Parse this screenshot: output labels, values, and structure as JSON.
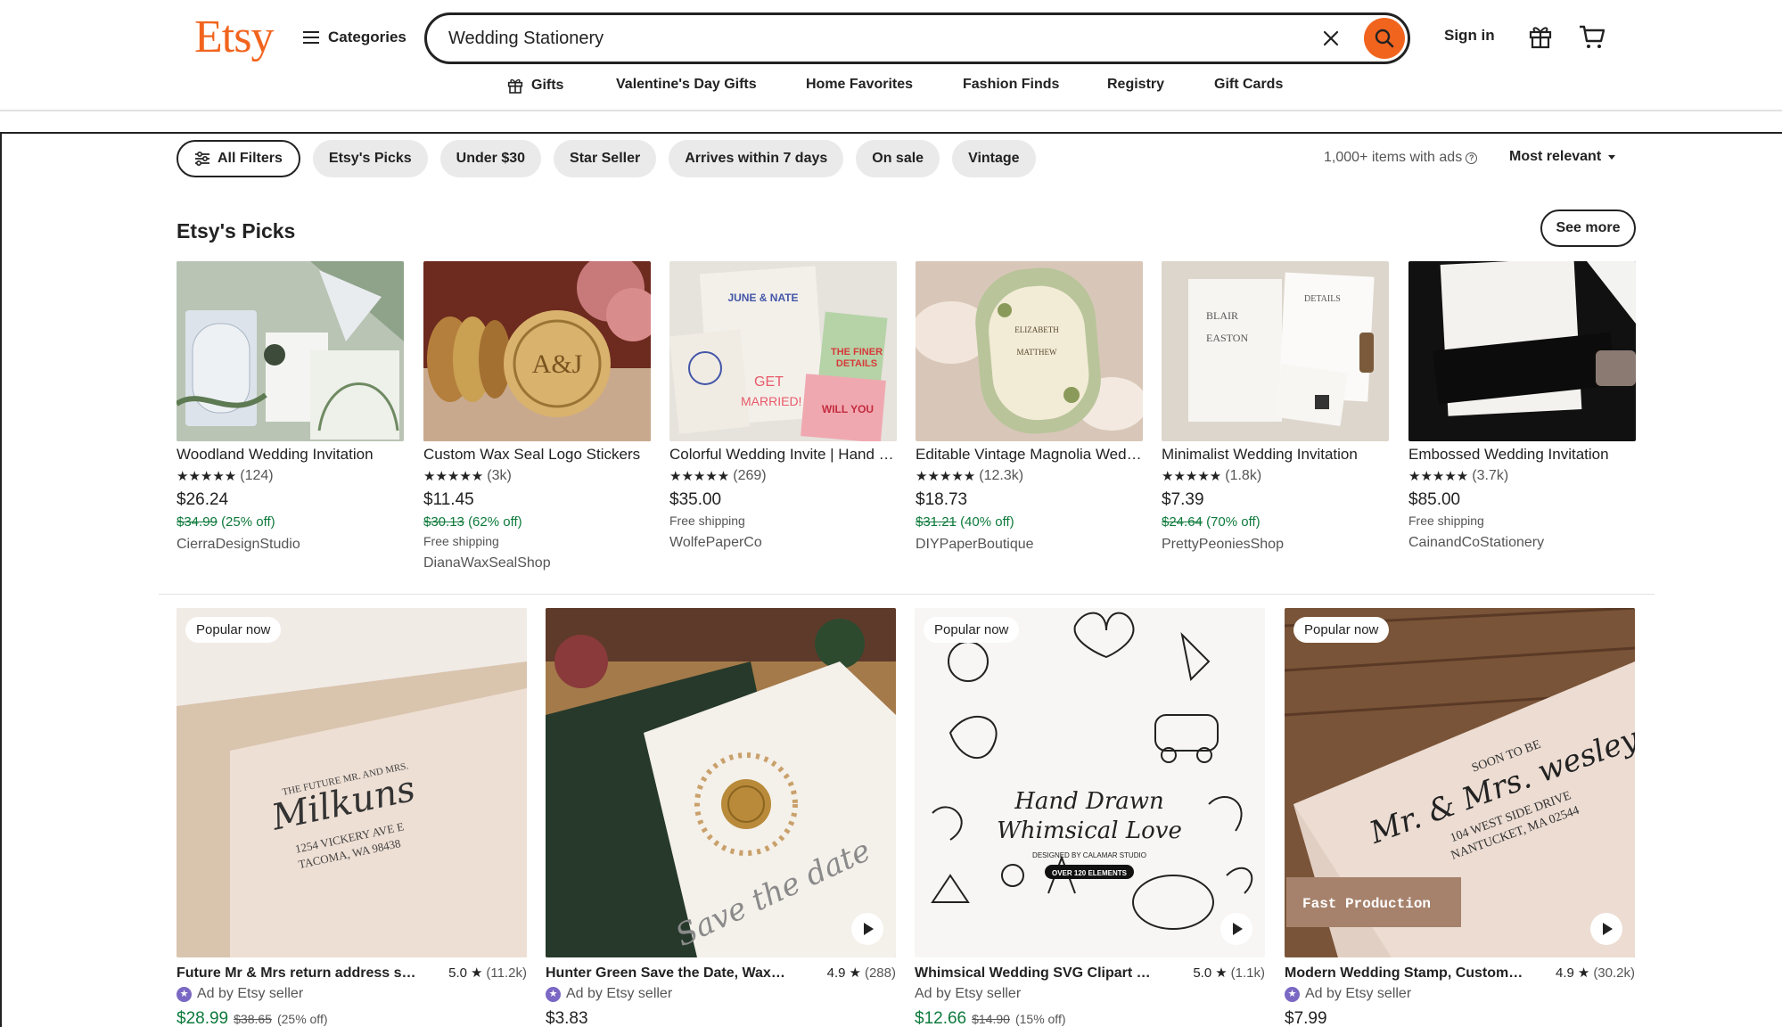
{
  "header": {
    "logo": "Etsy",
    "categories_label": "Categories",
    "search_value": "Wedding Stationery",
    "sign_in": "Sign in"
  },
  "nav": [
    "Gifts",
    "Valentine's Day Gifts",
    "Home Favorites",
    "Fashion Finds",
    "Registry",
    "Gift Cards"
  ],
  "filters": {
    "all_filters": "All Filters",
    "chips": [
      "Etsy's Picks",
      "Under $30",
      "Star Seller",
      "Arrives within 7 days",
      "On sale",
      "Vintage"
    ],
    "results": "1,000+ items with ads",
    "sort": "Most relevant"
  },
  "picks": {
    "title": "Etsy's Picks",
    "see_more": "See more",
    "items": [
      {
        "title": "Woodland Wedding Invitation",
        "rating": 5,
        "count": "(124)",
        "price": "$26.24",
        "old_price": "$34.99",
        "discount": "(25% off)",
        "shipping": "",
        "shop": "CierraDesignStudio"
      },
      {
        "title": "Custom Wax Seal Logo Stickers",
        "rating": 5,
        "count": "(3k)",
        "price": "$11.45",
        "old_price": "$30.13",
        "discount": "(62% off)",
        "shipping": "Free shipping",
        "shop": "DianaWaxSealShop"
      },
      {
        "title": "Colorful Wedding Invite | Hand drawn",
        "rating": 5,
        "count": "(269)",
        "price": "$35.00",
        "old_price": "",
        "discount": "",
        "shipping": "Free shipping",
        "shop": "WolfePaperCo"
      },
      {
        "title": "Editable Vintage Magnolia Wedding",
        "rating": 5,
        "count": "(12.3k)",
        "price": "$18.73",
        "old_price": "$31.21",
        "discount": "(40% off)",
        "shipping": "",
        "shop": "DIYPaperBoutique"
      },
      {
        "title": "Minimalist Wedding Invitation",
        "rating": 5,
        "count": "(1.8k)",
        "price": "$7.39",
        "old_price": "$24.64",
        "discount": "(70% off)",
        "shipping": "",
        "shop": "PrettyPeoniesShop"
      },
      {
        "title": "Embossed Wedding Invitation",
        "rating": 5,
        "count": "(3.7k)",
        "price": "$85.00",
        "old_price": "",
        "discount": "",
        "shipping": "Free shipping",
        "shop": "CainandCoStationery"
      }
    ]
  },
  "ads": {
    "badge": "Popular now",
    "ad_label": "Ad by Etsy seller",
    "items": [
      {
        "title": "Future Mr & Mrs return address stamp",
        "score": "5.0",
        "count": "(11.2k)",
        "price": "$28.99",
        "old_price": "$38.65",
        "discount": "(25% off)",
        "popular": true,
        "video": false
      },
      {
        "title": "Hunter Green Save the Date, Wax Seal",
        "score": "4.9",
        "count": "(288)",
        "price": "$3.83",
        "old_price": "",
        "discount": "",
        "popular": false,
        "video": true
      },
      {
        "title": "Whimsical Wedding SVG Clipart Bundle",
        "score": "5.0",
        "count": "(1.1k)",
        "price": "$12.66",
        "old_price": "$14.90",
        "discount": "(15% off)",
        "popular": true,
        "video": true
      },
      {
        "title": "Modern Wedding Stamp, Custom Address",
        "score": "4.9",
        "count": "(30.2k)",
        "price": "$7.99",
        "old_price": "",
        "discount": "",
        "popular": true,
        "video": true
      }
    ],
    "stamp_text": {
      "a_line1": "THE FUTURE MR. AND MRS.",
      "a_name": "Milkuns",
      "a_line2": "1254 VICKERY AVE E",
      "a_line3": "TACOMA, WA 98438",
      "b_script": "Save the date",
      "c_line1": "Hand Drawn",
      "c_line2": "Whimsical Love",
      "c_line3": "DESIGNED BY CALAMAR STUDIO",
      "c_badge": "OVER 120 ELEMENTS",
      "d_line1": "SOON TO BE",
      "d_name": "Mr. & Mrs. wesley",
      "d_line2": "104 WEST SIDE DRIVE",
      "d_line3": "NANTUCKET, MA 02544",
      "d_tag": "Fast Production"
    }
  }
}
